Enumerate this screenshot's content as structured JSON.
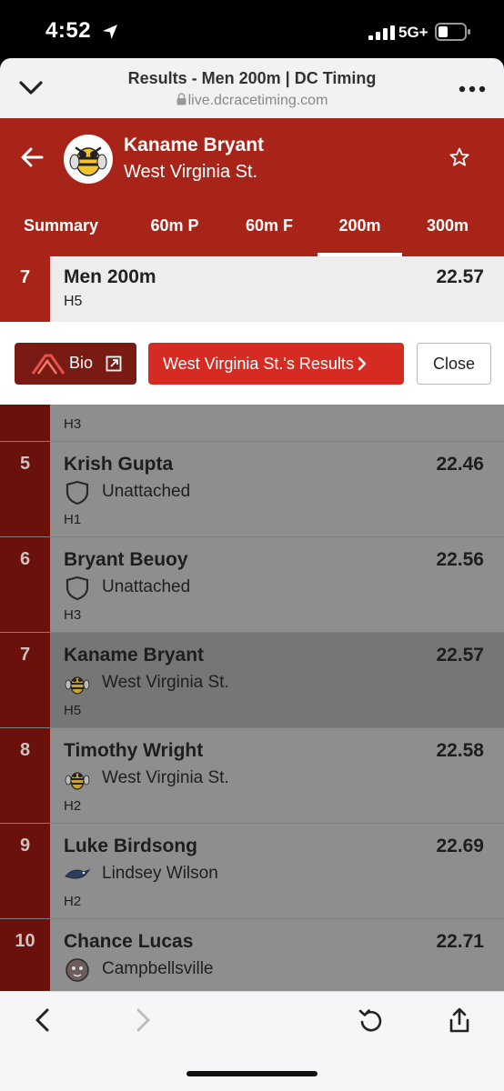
{
  "status_bar": {
    "time": "4:52",
    "network": "5G+"
  },
  "browser": {
    "title": "Results - Men 200m | DC Timing",
    "url": "live.dcracetiming.com"
  },
  "athlete": {
    "name": "Kaname Bryant",
    "team": "West Virginia St."
  },
  "tabs": [
    {
      "label": "Summary"
    },
    {
      "label": "60m P"
    },
    {
      "label": "60m F"
    },
    {
      "label": "200m"
    },
    {
      "label": "300m"
    }
  ],
  "active_tab": "200m",
  "selected": {
    "rank": "7",
    "event": "Men 200m",
    "heat": "H5",
    "time": "22.57"
  },
  "actions": {
    "bio_label": "Bio",
    "results_label": "West Virginia St.'s Results",
    "close_label": "Close"
  },
  "partial_row": {
    "heat": "H3"
  },
  "results": [
    {
      "rank": "5",
      "name": "Krish Gupta",
      "team": "Unattached",
      "team_icon": "shield-icon",
      "heat": "H1",
      "time": "22.46"
    },
    {
      "rank": "6",
      "name": "Bryant Beuoy",
      "team": "Unattached",
      "team_icon": "shield-icon",
      "heat": "H3",
      "time": "22.56"
    },
    {
      "rank": "7",
      "name": "Kaname Bryant",
      "team": "West Virginia St.",
      "team_icon": "yellow-jacket-logo",
      "heat": "H5",
      "time": "22.57"
    },
    {
      "rank": "8",
      "name": "Timothy Wright",
      "team": "West Virginia St.",
      "team_icon": "yellow-jacket-logo",
      "heat": "H2",
      "time": "22.58"
    },
    {
      "rank": "9",
      "name": "Luke Birdsong",
      "team": "Lindsey Wilson",
      "team_icon": "eagle-logo",
      "heat": "H2",
      "time": "22.69"
    },
    {
      "rank": "10",
      "name": "Chance Lucas",
      "team": "Campbellsville",
      "team_icon": "tiger-logo",
      "heat": "",
      "time": "22.71"
    }
  ],
  "colors": {
    "header_red": "#a82418",
    "button_red": "#d62b22",
    "bio_dark": "#7a1a14",
    "rank_dark": "#6a110b"
  }
}
